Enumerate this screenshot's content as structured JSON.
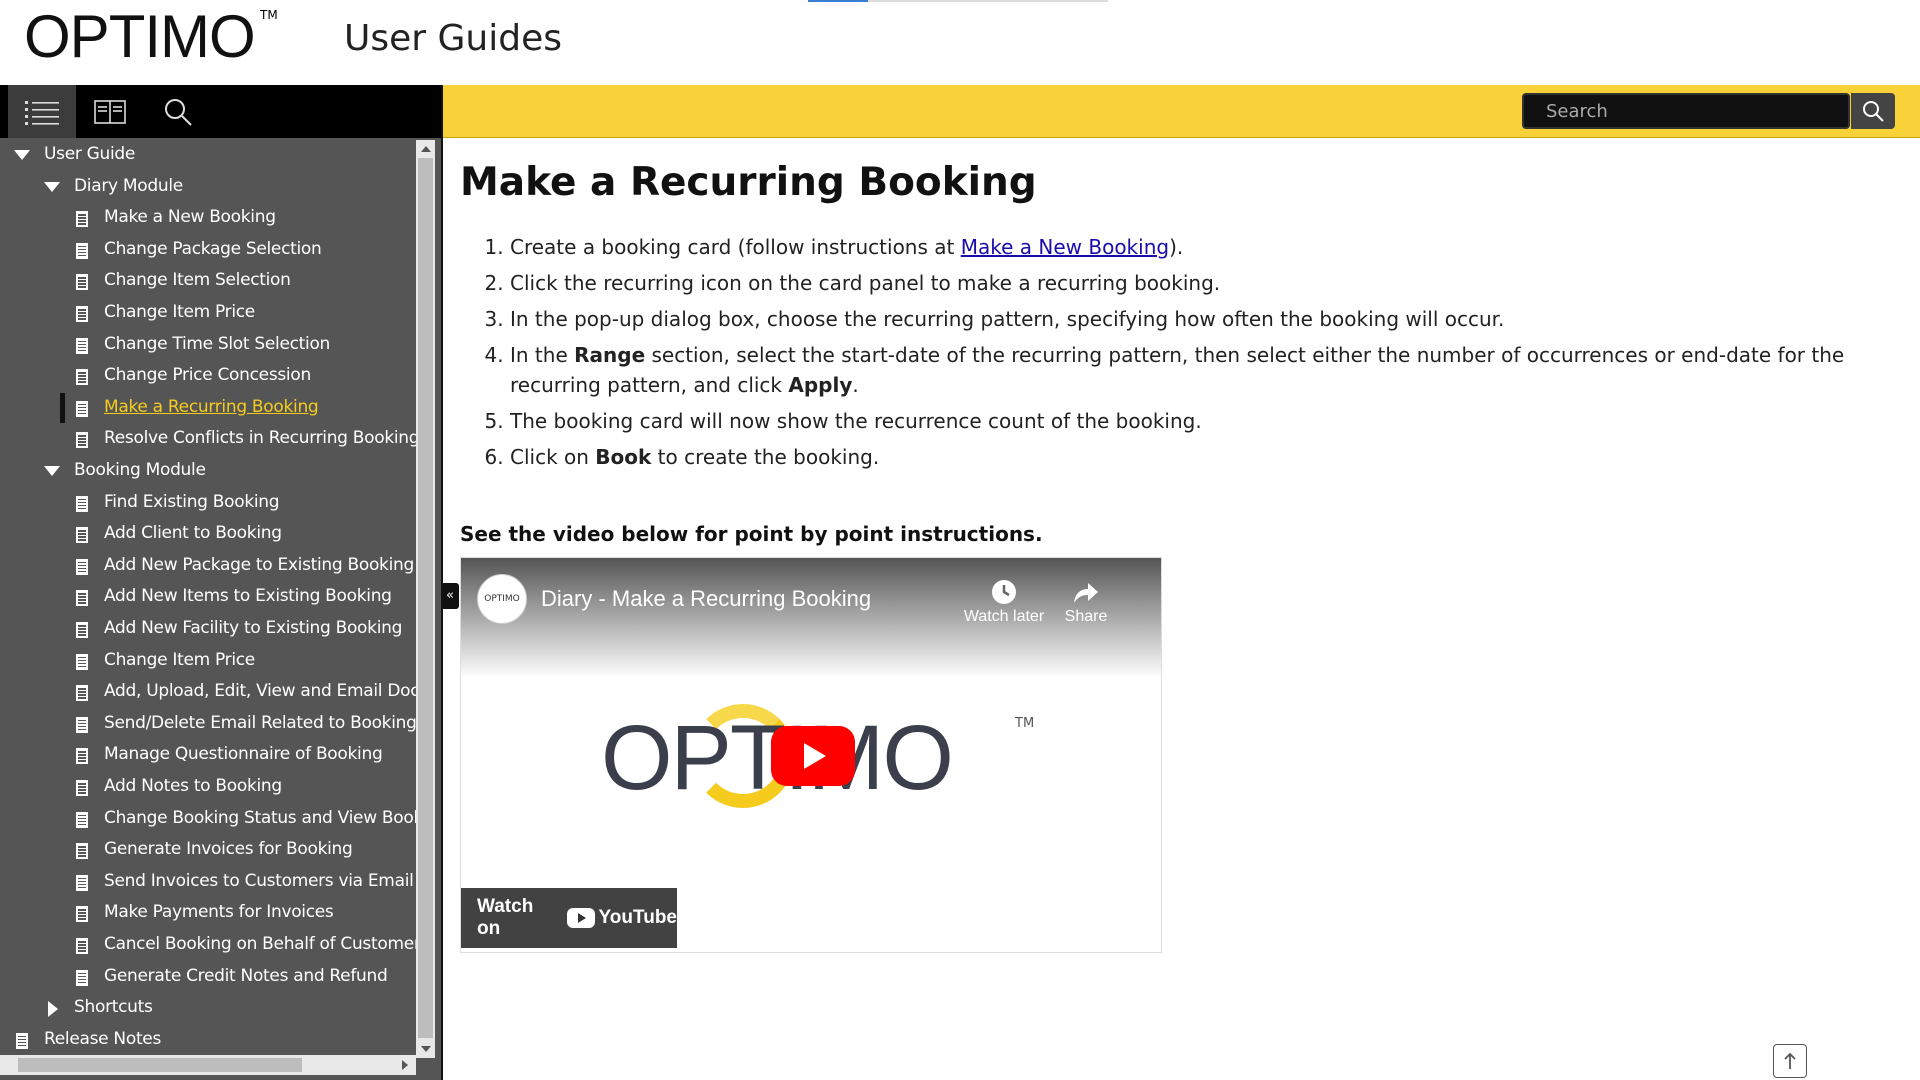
{
  "header": {
    "logo_text": "OPTIMO",
    "logo_tm": "TM",
    "title": "User Guides"
  },
  "toolbar": {
    "toc_icon": "list-icon",
    "index_icon": "book-icon",
    "search_icon": "search-icon"
  },
  "search": {
    "placeholder": "Search"
  },
  "tree": [
    {
      "label": "User Guide",
      "type": "folder-open",
      "level": 0
    },
    {
      "label": "Diary Module",
      "type": "folder-open",
      "level": 1
    },
    {
      "label": "Make a New Booking",
      "type": "page",
      "level": 2
    },
    {
      "label": "Change Package Selection",
      "type": "page",
      "level": 2
    },
    {
      "label": "Change Item Selection",
      "type": "page",
      "level": 2
    },
    {
      "label": "Change Item Price",
      "type": "page",
      "level": 2
    },
    {
      "label": "Change Time Slot Selection",
      "type": "page",
      "level": 2
    },
    {
      "label": "Change Price Concession",
      "type": "page",
      "level": 2
    },
    {
      "label": "Make a Recurring Booking",
      "type": "page",
      "level": 2,
      "selected": true
    },
    {
      "label": "Resolve Conflicts in Recurring Booking",
      "type": "page",
      "level": 2
    },
    {
      "label": "Booking Module",
      "type": "folder-open",
      "level": 1
    },
    {
      "label": "Find Existing Booking",
      "type": "page",
      "level": 2
    },
    {
      "label": "Add Client to Booking",
      "type": "page",
      "level": 2
    },
    {
      "label": "Add New Package to Existing Booking",
      "type": "page",
      "level": 2
    },
    {
      "label": "Add New Items to Existing Booking",
      "type": "page",
      "level": 2
    },
    {
      "label": "Add New Facility to Existing Booking",
      "type": "page",
      "level": 2
    },
    {
      "label": "Change Item Price",
      "type": "page",
      "level": 2
    },
    {
      "label": "Add, Upload, Edit, View and Email Docu",
      "type": "page",
      "level": 2
    },
    {
      "label": "Send/Delete Email Related to Booking",
      "type": "page",
      "level": 2
    },
    {
      "label": "Manage Questionnaire of Booking",
      "type": "page",
      "level": 2
    },
    {
      "label": "Add Notes to Booking",
      "type": "page",
      "level": 2
    },
    {
      "label": "Change Booking Status and View Bookin",
      "type": "page",
      "level": 2
    },
    {
      "label": "Generate Invoices for Booking",
      "type": "page",
      "level": 2
    },
    {
      "label": "Send Invoices to Customers via Email",
      "type": "page",
      "level": 2
    },
    {
      "label": "Make Payments for Invoices",
      "type": "page",
      "level": 2
    },
    {
      "label": "Cancel Booking on Behalf of Customer",
      "type": "page",
      "level": 2
    },
    {
      "label": "Generate Credit Notes and Refund",
      "type": "page",
      "level": 2
    },
    {
      "label": "Shortcuts",
      "type": "folder-closed",
      "level": 1
    },
    {
      "label": "Release Notes",
      "type": "page",
      "level": 0
    }
  ],
  "collapse_handle": "«",
  "content": {
    "title": "Make a Recurring Booking",
    "steps": [
      {
        "parts": [
          {
            "t": "Create a booking card (follow instructions at "
          },
          {
            "t": "Make a New Booking",
            "link": true
          },
          {
            "t": ")."
          }
        ]
      },
      {
        "parts": [
          {
            "t": "Click the recurring icon on the card panel to make a recurring booking."
          }
        ]
      },
      {
        "parts": [
          {
            "t": "In the pop-up dialog box, choose the recurring pattern, specifying how often the booking will occur."
          }
        ]
      },
      {
        "parts": [
          {
            "t": "In the "
          },
          {
            "t": "Range",
            "bold": true
          },
          {
            "t": " section, select the start-date of the recurring pattern, then select either the number of occurrences or end-date for the recurring pattern, and click "
          },
          {
            "t": "Apply",
            "bold": true
          },
          {
            "t": "."
          }
        ]
      },
      {
        "parts": [
          {
            "t": "The booking card will now show the recurrence count of the booking."
          }
        ]
      },
      {
        "parts": [
          {
            "t": "Click on "
          },
          {
            "t": "Book",
            "bold": true
          },
          {
            "t": " to create the booking."
          }
        ]
      }
    ],
    "video_note": "See the video below for point by point instructions."
  },
  "video": {
    "channel_avatar": "OPTIMO",
    "title": "Diary - Make a Recurring Booking",
    "watch_later": "Watch later",
    "share": "Share",
    "logo_text": "OPTIMO",
    "logo_tm": "TM",
    "watch_on": "Watch on",
    "youtube": "YouTube"
  }
}
